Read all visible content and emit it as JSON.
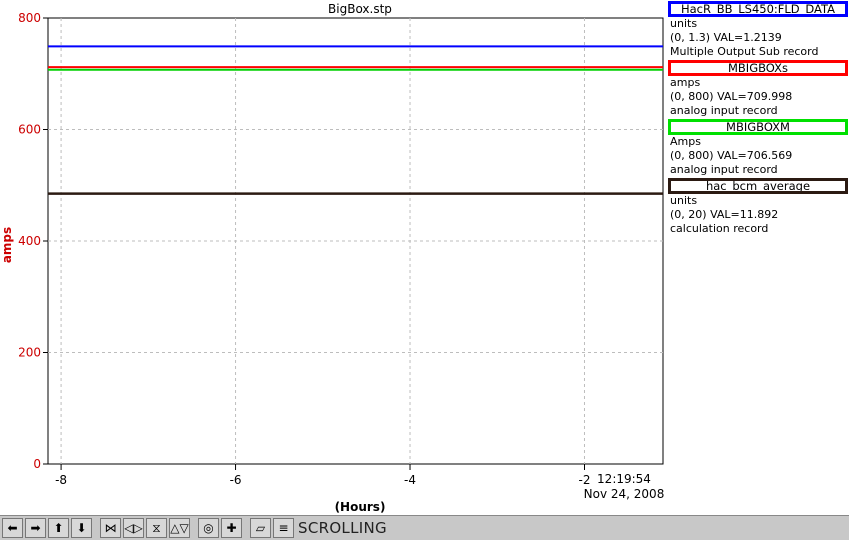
{
  "chart_data": {
    "type": "line",
    "title": "BigBox.stp",
    "xlabel": "(Hours)",
    "ylabel": "amps",
    "xlim": [
      -8.15,
      -1.1
    ],
    "ylim": [
      0,
      800
    ],
    "x_ticks": [
      -8,
      -6,
      -4,
      -2
    ],
    "y_ticks": [
      0,
      200,
      400,
      600,
      800
    ],
    "grid": true,
    "end_time": "12:19:54",
    "end_date": "Nov 24, 2008",
    "series": [
      {
        "name": "HacR_BB_LS450:FLD_DATA",
        "color": "#0000ff",
        "x": [
          -8.15,
          -1.1
        ],
        "y": [
          749,
          749
        ]
      },
      {
        "name": "MBIGBOXs",
        "color": "#ff0000",
        "x": [
          -8.15,
          -1.1
        ],
        "y": [
          712,
          712
        ]
      },
      {
        "name": "MBIGBOXM",
        "color": "#00d000",
        "x": [
          -8.15,
          -1.1
        ],
        "y": [
          707,
          707
        ]
      },
      {
        "name": "hac_bcm_average",
        "color": "#2b1a12",
        "x": [
          -8.15,
          -1.1
        ],
        "y": [
          485,
          485
        ]
      }
    ]
  },
  "legend": [
    {
      "name": "HacR_BB_LS450:FLD_DATA",
      "units": "units",
      "range": "(0, 1.3) VAL=1.2139",
      "record": "Multiple Output Sub record",
      "color": "#0000ff"
    },
    {
      "name": "MBIGBOXs",
      "units": "amps",
      "range": "(0, 800) VAL=709.998",
      "record": "analog input record",
      "color": "#ff0000"
    },
    {
      "name": "MBIGBOXM",
      "units": "Amps",
      "range": "(0, 800) VAL=706.569",
      "record": "analog input record",
      "color": "#00e000"
    },
    {
      "name": "hac_bcm_average",
      "units": "units",
      "range": "(0, 20) VAL=11.892",
      "record": "calculation record",
      "color": "#2b1a12"
    }
  ],
  "toolbar": {
    "status": "SCROLLING",
    "icons": [
      "arrow-left-icon",
      "arrow-right-icon",
      "arrow-up-icon",
      "arrow-down-icon",
      "expand-horizontal-icon",
      "shrink-horizontal-icon",
      "expand-vertical-icon",
      "shrink-vertical-icon",
      "center-icon",
      "add-icon",
      "auto-scale-icon",
      "scroll-mode-icon"
    ],
    "glyphs": [
      "⬅",
      "➡",
      "⬆",
      "⬇",
      "⋈",
      "◁▷",
      "⧖",
      "△▽",
      "◎",
      "✚",
      "⏥",
      "≡"
    ]
  },
  "colors": {
    "grid": "#bdbdbd",
    "axis_label": "#cc0000"
  }
}
